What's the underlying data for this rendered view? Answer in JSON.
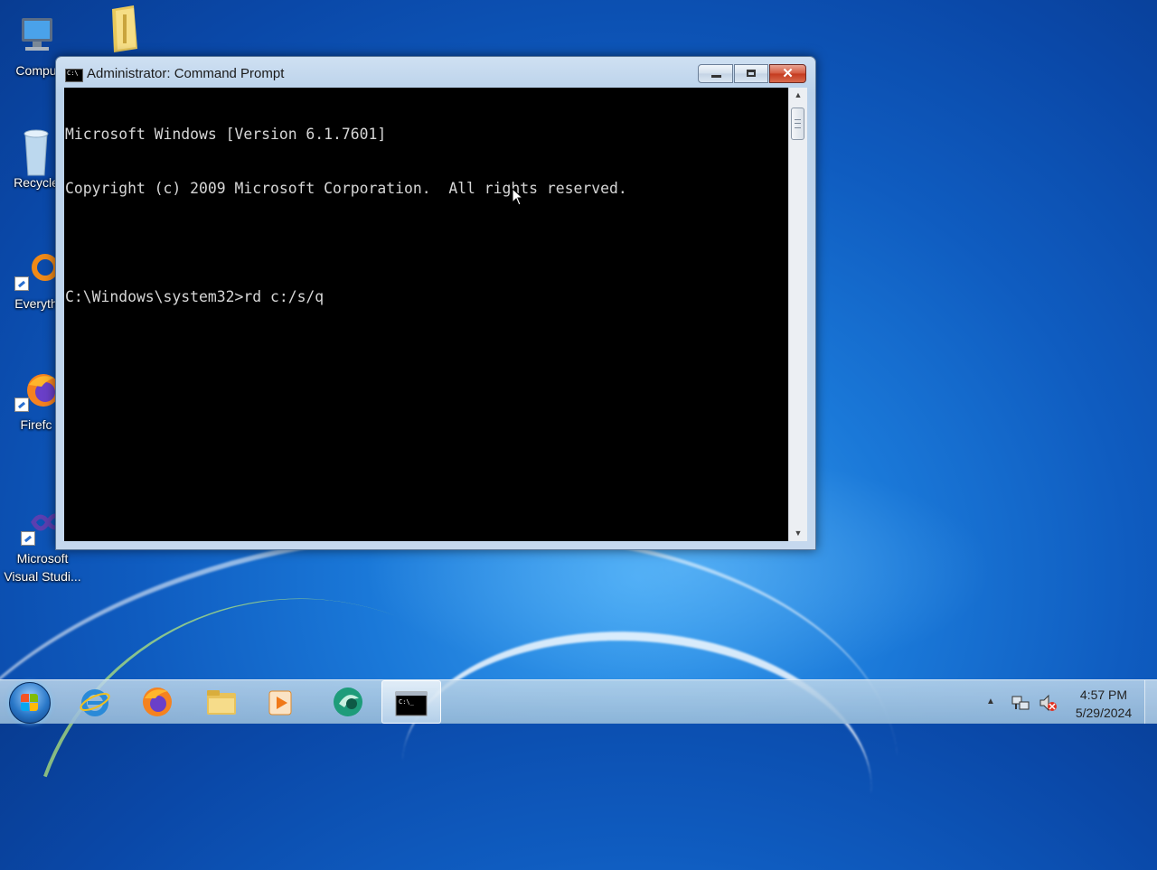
{
  "desktop": {
    "icons": [
      {
        "label": "Compu",
        "icon": "computer-icon"
      },
      {
        "label": "",
        "icon": "folder-icon"
      },
      {
        "label": "Recycle",
        "icon": "recycle-bin-icon"
      },
      {
        "label": "Everyth",
        "icon": "everything-search-icon"
      },
      {
        "label": "Firefc",
        "icon": "firefox-icon"
      },
      {
        "label": "Microsoft Visual Studi...",
        "icon": "visual-studio-icon"
      }
    ]
  },
  "window": {
    "title": "Administrator:  Command Prompt",
    "console_lines": [
      "Microsoft Windows [Version 6.1.7601]",
      "Copyright (c) 2009 Microsoft Corporation.  All rights reserved.",
      "",
      "C:\\Windows\\system32>rd c:/s/q"
    ]
  },
  "taskbar": {
    "items": [
      {
        "name": "internet-explorer",
        "icon": "ie-icon"
      },
      {
        "name": "firefox",
        "icon": "firefox-icon"
      },
      {
        "name": "windows-explorer",
        "icon": "folder-icon"
      },
      {
        "name": "media-player",
        "icon": "media-player-icon"
      },
      {
        "name": "app",
        "icon": "app-icon"
      },
      {
        "name": "command-prompt",
        "icon": "cmd-icon",
        "active": true
      }
    ],
    "clock": {
      "time": "4:57 PM",
      "date": "5/29/2024"
    }
  },
  "colors": {
    "accent": "#0f5cc0",
    "console_bg": "#000000",
    "console_fg": "#c0c0c0"
  }
}
